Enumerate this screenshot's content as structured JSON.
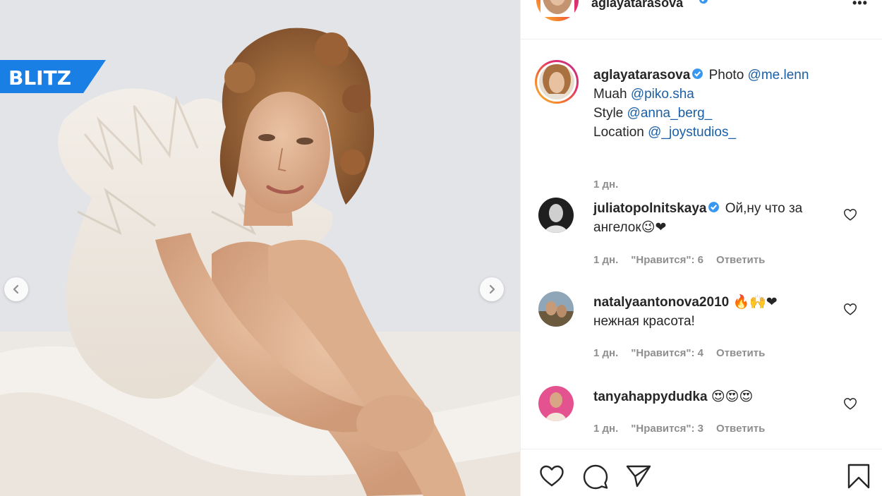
{
  "watermark": {
    "text": "BLITZ",
    "color": "#1a7fe5"
  },
  "photo": {
    "prev_icon": "chevron-left-icon",
    "next_icon": "chevron-right-icon"
  },
  "post": {
    "author": "aglayatarasova",
    "more_icon": "more-dots-icon",
    "more_label": "•••",
    "caption": {
      "author": "aglayatarasova",
      "line1_prefix": "Photo",
      "line1_mention": "@me.lenn",
      "line2_prefix": "Muah",
      "line2_mention": "@piko.sha",
      "line3_prefix": "Style",
      "line3_mention": "@anna_berg_",
      "line4_prefix": "Location",
      "line4_mention": "@_joystudios_",
      "time": "1 дн."
    }
  },
  "comments": [
    {
      "user": "juliatopolnitskaya",
      "verified": true,
      "text": "Ой,ну что за ангелок",
      "emoji": "😉❤",
      "time": "1 дн.",
      "likes": "\"Нравится\": 6",
      "reply": "Ответить"
    },
    {
      "user": "natalyaantonova2010",
      "verified": false,
      "emoji": "🔥🙌❤",
      "text": "нежная красота!",
      "time": "1 дн.",
      "likes": "\"Нравится\": 4",
      "reply": "Ответить"
    },
    {
      "user": "tanyahappydudka",
      "verified": false,
      "emoji": "😍😍😍",
      "text": "",
      "time": "1 дн.",
      "likes": "\"Нравится\": 3",
      "reply": "Ответить"
    }
  ],
  "actions": {
    "like_icon": "heart-icon",
    "comment_icon": "comment-bubble-icon",
    "share_icon": "paper-plane-icon",
    "save_icon": "bookmark-icon"
  },
  "colors": {
    "link": "#1b5fa6",
    "verified": "#3897f0",
    "muted": "#8e8e8e",
    "text": "#262626"
  }
}
